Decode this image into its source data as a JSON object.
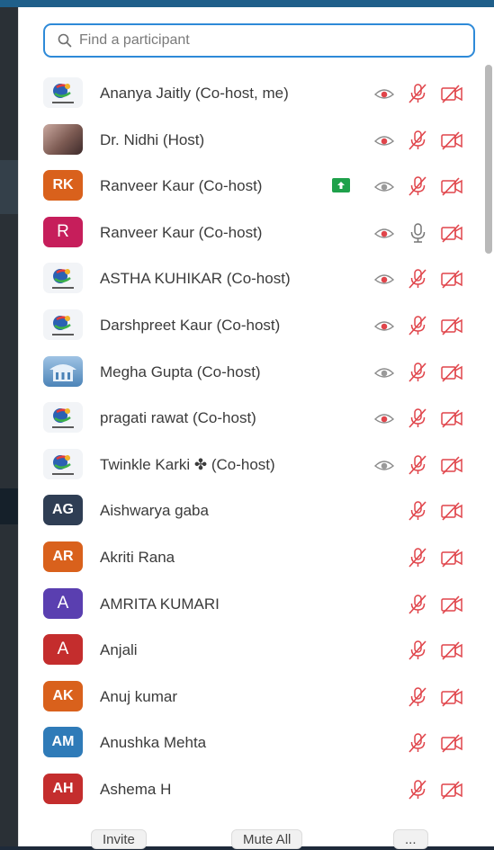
{
  "search": {
    "placeholder": "Find a participant",
    "icon": "search-icon"
  },
  "participants": [
    {
      "name": "Ananya Jaitly (Co-host, me)",
      "avatar": "logo",
      "initials": "",
      "color": "",
      "eye": true,
      "eye_active": true,
      "share": false,
      "mic": "muted"
    },
    {
      "name": "Dr. Nidhi (Host)",
      "avatar": "photo",
      "initials": "",
      "color": "",
      "eye": true,
      "eye_active": true,
      "share": false,
      "mic": "muted"
    },
    {
      "name": "Ranveer Kaur (Co-host)",
      "avatar": "initials",
      "initials": "RK",
      "color": "#d9611c",
      "eye": true,
      "eye_active": false,
      "share": true,
      "mic": "muted"
    },
    {
      "name": "Ranveer Kaur (Co-host)",
      "avatar": "initials",
      "initials": "R",
      "color": "#c61e5b",
      "eye": true,
      "eye_active": true,
      "share": false,
      "mic": "on"
    },
    {
      "name": "ASTHA KUHIKAR (Co-host)",
      "avatar": "logo",
      "initials": "",
      "color": "",
      "eye": true,
      "eye_active": true,
      "share": false,
      "mic": "muted"
    },
    {
      "name": "Darshpreet Kaur (Co-host)",
      "avatar": "logo",
      "initials": "",
      "color": "",
      "eye": true,
      "eye_active": true,
      "share": false,
      "mic": "muted"
    },
    {
      "name": "Megha Gupta (Co-host)",
      "avatar": "building",
      "initials": "",
      "color": "",
      "eye": true,
      "eye_active": false,
      "share": false,
      "mic": "muted"
    },
    {
      "name": "pragati rawat (Co-host)",
      "avatar": "logo",
      "initials": "",
      "color": "",
      "eye": true,
      "eye_active": true,
      "share": false,
      "mic": "muted"
    },
    {
      "name": "Twinkle Karki ✤ (Co-host)",
      "avatar": "logo",
      "initials": "",
      "color": "",
      "eye": true,
      "eye_active": false,
      "share": false,
      "mic": "muted"
    },
    {
      "name": "Aishwarya gaba",
      "avatar": "initials",
      "initials": "AG",
      "color": "#2f3e54",
      "eye": false,
      "eye_active": false,
      "share": false,
      "mic": "muted"
    },
    {
      "name": "Akriti Rana",
      "avatar": "initials",
      "initials": "AR",
      "color": "#d9611c",
      "eye": false,
      "eye_active": false,
      "share": false,
      "mic": "muted"
    },
    {
      "name": "AMRITA KUMARI",
      "avatar": "initials",
      "initials": "A",
      "color": "#5a3fb0",
      "eye": false,
      "eye_active": false,
      "share": false,
      "mic": "muted"
    },
    {
      "name": "Anjali",
      "avatar": "initials",
      "initials": "A",
      "color": "#c42d2d",
      "eye": false,
      "eye_active": false,
      "share": false,
      "mic": "muted"
    },
    {
      "name": "Anuj kumar",
      "avatar": "initials",
      "initials": "AK",
      "color": "#d9611c",
      "eye": false,
      "eye_active": false,
      "share": false,
      "mic": "muted"
    },
    {
      "name": "Anushka Mehta",
      "avatar": "initials",
      "initials": "AM",
      "color": "#2f7bb8",
      "eye": false,
      "eye_active": false,
      "share": false,
      "mic": "muted"
    },
    {
      "name": "Ashema H",
      "avatar": "initials",
      "initials": "AH",
      "color": "#c42d2d",
      "eye": false,
      "eye_active": false,
      "share": false,
      "mic": "muted"
    }
  ],
  "footer": {
    "invite": "Invite",
    "mute_all": "Mute All",
    "more": "..."
  },
  "colors": {
    "accent": "#2e8ad8",
    "muted_red": "#e0454b",
    "share_green": "#1fa14b"
  }
}
